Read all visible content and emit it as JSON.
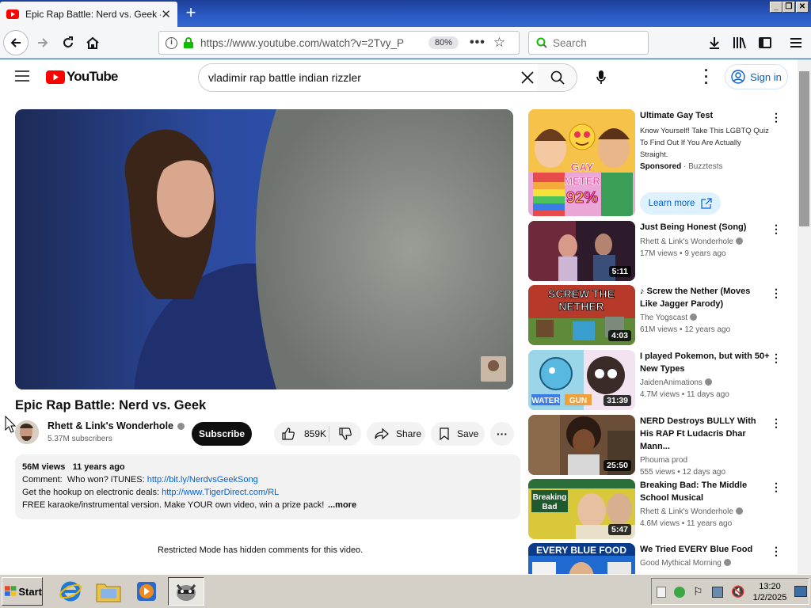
{
  "browser": {
    "tab_title": "Epic Rap Battle: Nerd vs. Geek - YouTube",
    "url": "https://www.youtube.com/watch?v=2Tvy_P",
    "zoom": "80%",
    "search_placeholder": "Search"
  },
  "youtube": {
    "logo_text": "YouTube",
    "search_query": "vladimir rap battle indian rizzler",
    "sign_in": "Sign in",
    "video": {
      "title": "Epic Rap Battle: Nerd vs. Geek",
      "channel": "Rhett & Link's Wonderhole",
      "subscribers": "5.37M subscribers",
      "subscribe": "Subscribe",
      "likes": "859K",
      "share": "Share",
      "save": "Save",
      "description": {
        "views": "56M views",
        "age": "11 years ago",
        "line1_text": "Comment:  Who won? iTUNES: ",
        "line1_link": "http://bit.ly/NerdvsGeekSong",
        "line2_text": "Get the hookup on electronic deals: ",
        "line2_link": "http://www.TigerDirect.com/RL",
        "line3_text": "FREE karaoke/instrumental version. Make YOUR own video, win a prize pack!",
        "more": "...more"
      },
      "restricted_notice": "Restricted Mode has hidden comments for this video."
    },
    "recommendations": [
      {
        "title": "Ultimate Gay Test",
        "desc": "Know Yourself! Take This LGBTQ Quiz To Find Out If You Are Actually Straight.",
        "sponsored": "Sponsored",
        "advertiser": "Buzztests",
        "cta": "Learn more",
        "thumb_text": "GAY METER 92%"
      },
      {
        "title": "Just Being Honest (Song)",
        "channel": "Rhett & Link's Wonderhole",
        "views": "17M views",
        "age": "9 years ago",
        "duration": "5:11"
      },
      {
        "title": "♪ Screw the Nether (Moves Like Jagger Parody)",
        "channel": "The Yogscast",
        "views": "61M views",
        "age": "12 years ago",
        "duration": "4:03",
        "thumb_text": "SCREW THE NETHER"
      },
      {
        "title": "I played Pokemon, but with 50+ New Types",
        "channel": "JaidenAnimations",
        "views": "4.7M views",
        "age": "11 days ago",
        "duration": "31:39",
        "thumb_text": "WATER GUN"
      },
      {
        "title": "NERD Destroys BULLY With His RAP Ft Ludacris Dhar Mann...",
        "channel": "Phouma prod",
        "views": "555 views",
        "age": "12 days ago",
        "duration": "25:50"
      },
      {
        "title": "Breaking Bad: The Middle School Musical",
        "channel": "Rhett & Link's Wonderhole",
        "views": "4.6M views",
        "age": "11 years ago",
        "duration": "5:47",
        "thumb_text": "Breaking Bad"
      },
      {
        "title": "We Tried EVERY Blue Food",
        "channel": "Good Mythical Morning",
        "thumb_text": "EVERY BLUE FOOD"
      }
    ]
  },
  "taskbar": {
    "start": "Start",
    "time": "13:20",
    "date": "1/2/2025"
  },
  "colors": {
    "youtube_red": "#ff0000",
    "link_blue": "#065fd4",
    "win_blue": "#3a6ea5"
  }
}
